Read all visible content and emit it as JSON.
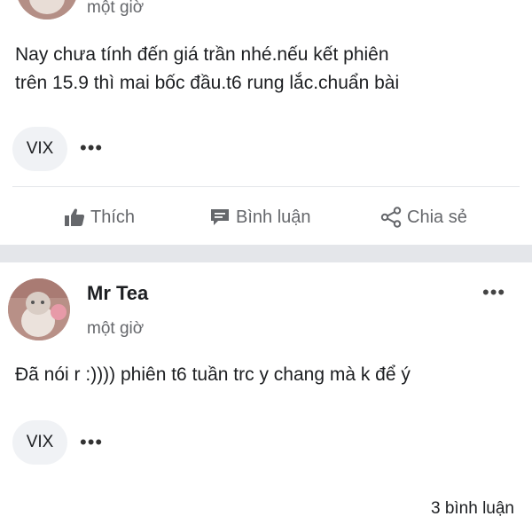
{
  "post1": {
    "time": "một giờ",
    "content_line1": "Nay chưa tính đến giá trần nhé.nếu kết phiên",
    "content_line2": "trên 15.9 thì mai bốc đầu.t6 rung lắc.chuẩn bài",
    "tag": "VIX",
    "tag_more": "•••",
    "actions": {
      "like": "Thích",
      "comment": "Bình luận",
      "share": "Chia sẻ"
    }
  },
  "post2": {
    "author": "Mr Tea",
    "time": "một giờ",
    "more": "•••",
    "content": "Đã nói r :)))) phiên t6 tuần trc y chang mà k để ý",
    "tag": "VIX",
    "tag_more": "•••",
    "comment_count": "3 bình luận"
  },
  "icons": {
    "like": "thumbs-up-icon",
    "comment": "comment-icon",
    "share": "share-icon",
    "more": "more-dots-icon"
  },
  "colors": {
    "text": "#1c1e21",
    "secondary": "#65676b",
    "separator": "#e4e6ea",
    "tag_bg": "#f0f2f5"
  }
}
